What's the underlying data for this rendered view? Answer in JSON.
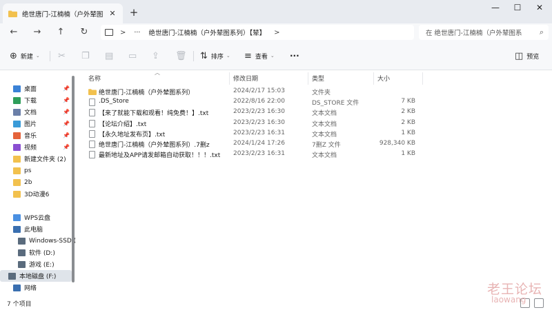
{
  "tab": {
    "title": "绝世唐门-江楠楠（户外辇图系列",
    "close": "✕",
    "new": "+"
  },
  "window": {
    "minimize": "—",
    "maximize": "☐",
    "close": "✕"
  },
  "nav": {
    "back": "←",
    "forward": "→",
    "up": "↑",
    "refresh": "↻"
  },
  "address": {
    "ellipsis": "···",
    "sep": ">",
    "path": "绝世唐门-江楠楠（户外辇图系列）【辇】",
    "trail": ">"
  },
  "search": {
    "placeholder": "在 绝世唐门-江楠楠（户外辇图系",
    "icon": "⌕"
  },
  "toolbar": {
    "new_label": "新建",
    "sort_label": "排序",
    "view_label": "查看",
    "more": "···",
    "preview_label": "预览"
  },
  "sidebar": {
    "items": [
      {
        "label": "桌面",
        "color": "#3b82d6",
        "pinned": true
      },
      {
        "label": "下载",
        "color": "#2f9e5a",
        "pinned": true
      },
      {
        "label": "文档",
        "color": "#6b7fa8",
        "pinned": true
      },
      {
        "label": "图片",
        "color": "#3a9bd8",
        "pinned": true
      },
      {
        "label": "音乐",
        "color": "#e5633b",
        "pinned": true
      },
      {
        "label": "视频",
        "color": "#8a4fd1",
        "pinned": true
      },
      {
        "label": "新建文件夹 (2)",
        "color": "#f2c14e",
        "pinned": false
      },
      {
        "label": "ps",
        "color": "#f2c14e",
        "pinned": false
      },
      {
        "label": "2b",
        "color": "#f2c14e",
        "pinned": false
      },
      {
        "label": "3D动漫6",
        "color": "#f2c14e",
        "pinned": false
      },
      {
        "label": "WPS云盘",
        "color": "#4a90e2",
        "pinned": false
      },
      {
        "label": "此电脑",
        "color": "#3a6fb0",
        "pinned": false
      },
      {
        "label": "Windows-SSD (",
        "color": "#5a6b7d",
        "pinned": false
      },
      {
        "label": "软件 (D:)",
        "color": "#5a6b7d",
        "pinned": false
      },
      {
        "label": "游戏 (E:)",
        "color": "#5a6b7d",
        "pinned": false
      },
      {
        "label": "本地磁盘 (F:)",
        "color": "#5a6b7d",
        "pinned": false
      },
      {
        "label": "网络",
        "color": "#3a6fb0",
        "pinned": false
      }
    ]
  },
  "columns": {
    "name": "名称",
    "date": "修改日期",
    "type": "类型",
    "size": "大小"
  },
  "files": [
    {
      "name": "绝世唐门-江楠楠（户外辇图系列）",
      "date": "2024/2/17 15:03",
      "type": "文件夹",
      "size": "",
      "kind": "folder"
    },
    {
      "name": ".DS_Store",
      "date": "2022/8/16 22:00",
      "type": "DS_STORE 文件",
      "size": "7 KB",
      "kind": "file"
    },
    {
      "name": "【来了就能下载和观看！纯免费！】.txt",
      "date": "2023/2/23 16:30",
      "type": "文本文档",
      "size": "2 KB",
      "kind": "file"
    },
    {
      "name": "【论坛介绍】.txt",
      "date": "2023/2/23 16:30",
      "type": "文本文档",
      "size": "2 KB",
      "kind": "file"
    },
    {
      "name": "【永久地址发布页】.txt",
      "date": "2023/2/23 16:31",
      "type": "文本文档",
      "size": "1 KB",
      "kind": "file"
    },
    {
      "name": "绝世唐门-江楠楠（户外辇图系列）.7删z",
      "date": "2024/1/24 17:26",
      "type": "7删Z 文件",
      "size": "928,340 KB",
      "kind": "file"
    },
    {
      "name": "最新地址及APP请发邮箱自动获取！！！.txt",
      "date": "2023/2/23 16:31",
      "type": "文本文档",
      "size": "1 KB",
      "kind": "file"
    }
  ],
  "status": {
    "count": "7 个项目"
  },
  "watermark": {
    "line1": "老王论坛",
    "line2": "laowang"
  }
}
